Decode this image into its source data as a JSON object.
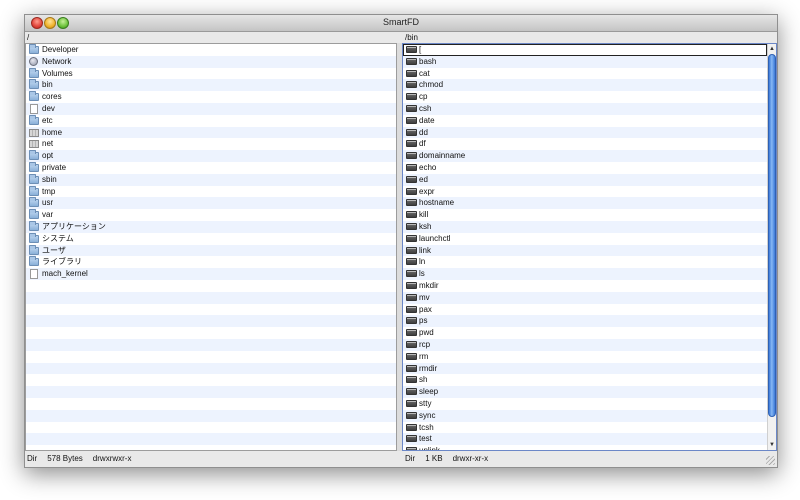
{
  "window": {
    "title": "SmartFD"
  },
  "left_panel": {
    "path": "/",
    "items": [
      {
        "name": "Developer",
        "icon": "folder-icon"
      },
      {
        "name": "Network",
        "icon": "network-icon"
      },
      {
        "name": "Volumes",
        "icon": "folder-icon"
      },
      {
        "name": "bin",
        "icon": "folder-icon"
      },
      {
        "name": "cores",
        "icon": "folder-icon"
      },
      {
        "name": "dev",
        "icon": "file-icon"
      },
      {
        "name": "etc",
        "icon": "folder-icon"
      },
      {
        "name": "home",
        "icon": "home-icon"
      },
      {
        "name": "net",
        "icon": "home-icon"
      },
      {
        "name": "opt",
        "icon": "folder-icon"
      },
      {
        "name": "private",
        "icon": "folder-icon"
      },
      {
        "name": "sbin",
        "icon": "folder-icon"
      },
      {
        "name": "tmp",
        "icon": "folder-icon"
      },
      {
        "name": "usr",
        "icon": "folder-icon"
      },
      {
        "name": "var",
        "icon": "folder-icon"
      },
      {
        "name": "アプリケーション",
        "icon": "folder-icon"
      },
      {
        "name": "システム",
        "icon": "folder-icon"
      },
      {
        "name": "ユーザ",
        "icon": "folder-icon"
      },
      {
        "name": "ライブラリ",
        "icon": "folder-icon"
      },
      {
        "name": "mach_kernel",
        "icon": "file-icon"
      }
    ],
    "status": {
      "type": "Dir",
      "size": "578 Bytes",
      "permissions": "drwxrwxr-x"
    }
  },
  "right_panel": {
    "path": "/bin",
    "items": [
      {
        "name": "[",
        "icon": "executable-icon"
      },
      {
        "name": "bash",
        "icon": "executable-icon"
      },
      {
        "name": "cat",
        "icon": "executable-icon"
      },
      {
        "name": "chmod",
        "icon": "executable-icon"
      },
      {
        "name": "cp",
        "icon": "executable-icon"
      },
      {
        "name": "csh",
        "icon": "executable-icon"
      },
      {
        "name": "date",
        "icon": "executable-icon"
      },
      {
        "name": "dd",
        "icon": "executable-icon"
      },
      {
        "name": "df",
        "icon": "executable-icon"
      },
      {
        "name": "domainname",
        "icon": "executable-icon"
      },
      {
        "name": "echo",
        "icon": "executable-icon"
      },
      {
        "name": "ed",
        "icon": "executable-icon"
      },
      {
        "name": "expr",
        "icon": "executable-icon"
      },
      {
        "name": "hostname",
        "icon": "executable-icon"
      },
      {
        "name": "kill",
        "icon": "executable-icon"
      },
      {
        "name": "ksh",
        "icon": "executable-icon"
      },
      {
        "name": "launchctl",
        "icon": "executable-icon"
      },
      {
        "name": "link",
        "icon": "executable-icon"
      },
      {
        "name": "ln",
        "icon": "executable-icon"
      },
      {
        "name": "ls",
        "icon": "executable-icon"
      },
      {
        "name": "mkdir",
        "icon": "executable-icon"
      },
      {
        "name": "mv",
        "icon": "executable-icon"
      },
      {
        "name": "pax",
        "icon": "executable-icon"
      },
      {
        "name": "ps",
        "icon": "executable-icon"
      },
      {
        "name": "pwd",
        "icon": "executable-icon"
      },
      {
        "name": "rcp",
        "icon": "executable-icon"
      },
      {
        "name": "rm",
        "icon": "executable-icon"
      },
      {
        "name": "rmdir",
        "icon": "executable-icon"
      },
      {
        "name": "sh",
        "icon": "executable-icon"
      },
      {
        "name": "sleep",
        "icon": "executable-icon"
      },
      {
        "name": "stty",
        "icon": "executable-icon"
      },
      {
        "name": "sync",
        "icon": "executable-icon"
      },
      {
        "name": "tcsh",
        "icon": "executable-icon"
      },
      {
        "name": "test",
        "icon": "executable-icon"
      },
      {
        "name": "unlink",
        "icon": "executable-icon"
      }
    ],
    "selected_index": 0,
    "status": {
      "type": "Dir",
      "size": "1 KB",
      "permissions": "drwxr-xr-x"
    }
  },
  "colors": {
    "row_stripe": "#edf3fe",
    "scroll_thumb": "#3a79d8",
    "active_border": "#6b87c7"
  }
}
